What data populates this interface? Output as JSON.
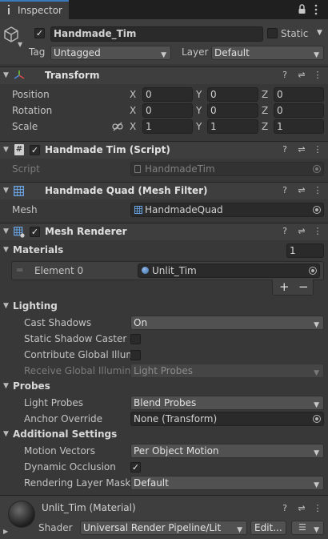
{
  "tab": {
    "label": "Inspector"
  },
  "header": {
    "object_name": "Handmade_Tim",
    "static_label": "Static",
    "tag_label": "Tag",
    "tag_value": "Untagged",
    "layer_label": "Layer",
    "layer_value": "Default"
  },
  "transform": {
    "title": "Transform",
    "rows": [
      {
        "label": "Position",
        "x": "0",
        "y": "0",
        "z": "0"
      },
      {
        "label": "Rotation",
        "x": "0",
        "y": "0",
        "z": "0"
      },
      {
        "label": "Scale",
        "x": "1",
        "y": "1",
        "z": "1"
      }
    ],
    "axis": {
      "x": "X",
      "y": "Y",
      "z": "Z"
    }
  },
  "script_comp": {
    "title": "Handmade Tim (Script)",
    "script_label": "Script",
    "script_value": "HandmadeTim"
  },
  "mesh_filter": {
    "title": "Handmade Quad (Mesh Filter)",
    "mesh_label": "Mesh",
    "mesh_value": "HandmadeQuad"
  },
  "mesh_renderer": {
    "title": "Mesh Renderer",
    "materials_label": "Materials",
    "materials_count": "1",
    "element_label": "Element 0",
    "element_value": "Unlit_Tim",
    "plus": "+",
    "minus": "−",
    "lighting": {
      "title": "Lighting",
      "cast_shadows_label": "Cast Shadows",
      "cast_shadows_value": "On",
      "static_shadow_label": "Static Shadow Caster",
      "contribute_gi_label": "Contribute Global Illum",
      "receive_gi_label": "Receive Global Illumina",
      "receive_gi_value": "Light Probes"
    },
    "probes": {
      "title": "Probes",
      "light_probes_label": "Light Probes",
      "light_probes_value": "Blend Probes",
      "anchor_label": "Anchor Override",
      "anchor_value": "None (Transform)"
    },
    "additional": {
      "title": "Additional Settings",
      "motion_label": "Motion Vectors",
      "motion_value": "Per Object Motion",
      "dynamic_occlusion_label": "Dynamic Occlusion",
      "rendering_layer_label": "Rendering Layer Mask",
      "rendering_layer_value": "Default"
    }
  },
  "material": {
    "title": "Unlit_Tim (Material)",
    "shader_label": "Shader",
    "shader_value": "Universal Render Pipeline/Lit",
    "edit_label": "Edit..."
  },
  "colors": {
    "accent": "#3a79bb",
    "panel": "#383838",
    "header": "#3e3e3e"
  }
}
